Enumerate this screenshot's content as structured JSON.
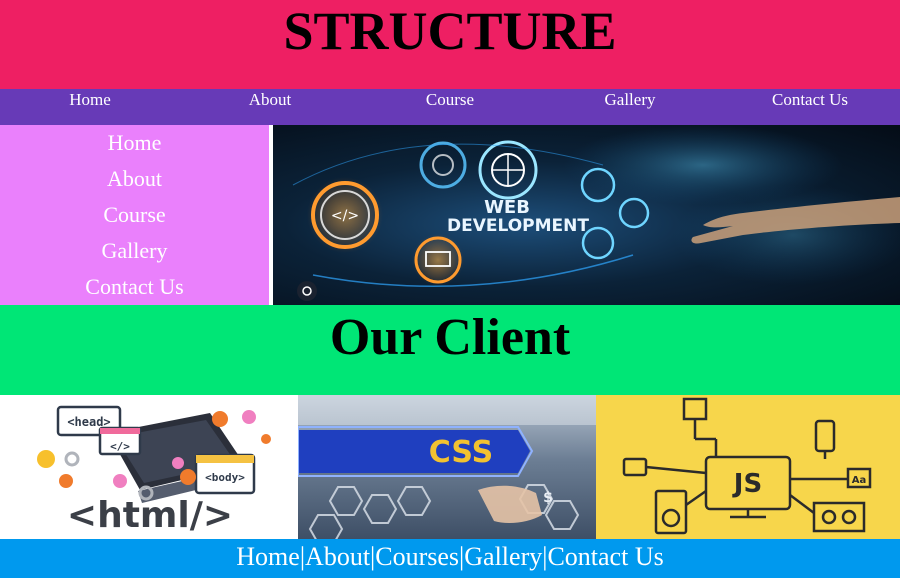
{
  "header": {
    "title": "STRUCTURE"
  },
  "topnav": {
    "items": [
      "Home",
      "About",
      "Course",
      "Gallery",
      "Contact Us"
    ]
  },
  "sidebar": {
    "items": [
      "Home",
      "About",
      "Course",
      "Gallery",
      "Contact Us"
    ]
  },
  "hero": {
    "line1": "WEB",
    "line2": "DEVELOPMENT"
  },
  "client": {
    "title": "Our Client"
  },
  "tiles": {
    "html": {
      "head": "<head>",
      "code": "</>",
      "body": "<body>",
      "caption": "<html/>"
    },
    "css": {
      "label": "CSS"
    },
    "js": {
      "label": "JS",
      "aa": "Aa"
    }
  },
  "footer": {
    "items": [
      "Home",
      "About",
      "Courses",
      "Gallery",
      "Contact Us"
    ],
    "separator": "|"
  },
  "colors": {
    "header": "#ee1f63",
    "topnav": "#673ab7",
    "sidebar": "#ea80fc",
    "client": "#00e676",
    "footer": "#0099ee",
    "js": "#f7d64b"
  }
}
